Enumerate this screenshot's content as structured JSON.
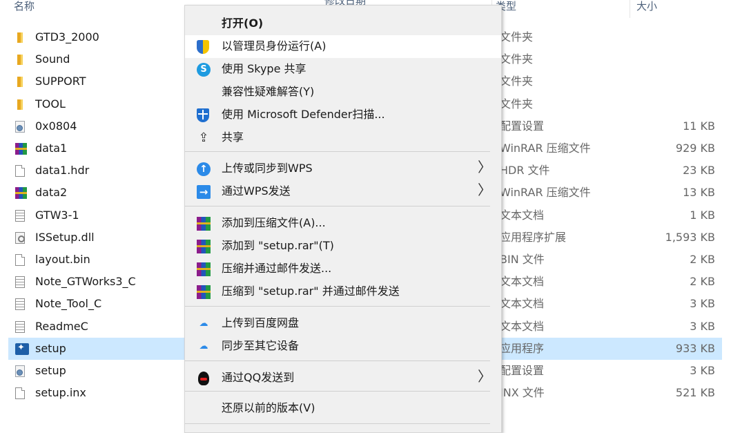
{
  "explorer": {
    "headers": {
      "name": "名称",
      "date": "修改日期",
      "type": "类型",
      "size": "大小"
    },
    "rows": [
      {
        "name": "GTD3_2000",
        "type": "文件夹",
        "size": "",
        "icon": "folder-icon"
      },
      {
        "name": "Sound",
        "type": "文件夹",
        "size": "",
        "icon": "folder-icon"
      },
      {
        "name": "SUPPORT",
        "type": "文件夹",
        "size": "",
        "icon": "folder-icon"
      },
      {
        "name": "TOOL",
        "type": "文件夹",
        "size": "",
        "icon": "folder-icon"
      },
      {
        "name": "0x0804",
        "type": "配置设置",
        "size": "11 KB",
        "icon": "config-file-icon"
      },
      {
        "name": "data1",
        "type": "WinRAR 压缩文件",
        "size": "929 KB",
        "icon": "winrar-archive-icon"
      },
      {
        "name": "data1.hdr",
        "type": "HDR 文件",
        "size": "23 KB",
        "icon": "blank-file-icon"
      },
      {
        "name": "data2",
        "type": "WinRAR 压缩文件",
        "size": "13 KB",
        "icon": "winrar-archive-icon"
      },
      {
        "name": "GTW3-1",
        "type": "文本文档",
        "size": "1 KB",
        "icon": "text-file-icon"
      },
      {
        "name": "ISSetup.dll",
        "type": "应用程序扩展",
        "size": "1,593 KB",
        "icon": "dll-file-icon"
      },
      {
        "name": "layout.bin",
        "type": "BIN 文件",
        "size": "2 KB",
        "icon": "blank-file-icon"
      },
      {
        "name": "Note_GTWorks3_C",
        "type": "文本文档",
        "size": "2 KB",
        "icon": "text-file-icon"
      },
      {
        "name": "Note_Tool_C",
        "type": "文本文档",
        "size": "3 KB",
        "icon": "text-file-icon"
      },
      {
        "name": "ReadmeC",
        "type": "文本文档",
        "size": "3 KB",
        "icon": "text-file-icon"
      },
      {
        "name": "setup",
        "type": "应用程序",
        "size": "933 KB",
        "icon": "setup-app-icon"
      },
      {
        "name": "setup",
        "type": "配置设置",
        "size": "3 KB",
        "icon": "config-file-icon"
      },
      {
        "name": "setup.inx",
        "type": "INX 文件",
        "size": "521 KB",
        "icon": "blank-file-icon"
      }
    ],
    "selected_row": 14
  },
  "context_menu": {
    "items": [
      {
        "label": "打开(O)",
        "icon": "",
        "bold": true
      },
      {
        "label": "以管理员身份运行(A)",
        "icon": "uac-shield-icon",
        "hover": true
      },
      {
        "label": "使用 Skype 共享",
        "icon": "skype-icon",
        "glyph": "S"
      },
      {
        "label": "兼容性疑难解答(Y)",
        "icon": ""
      },
      {
        "label": "使用 Microsoft Defender扫描...",
        "icon": "defender-icon"
      },
      {
        "label": "共享",
        "icon": "share-icon",
        "glyph": "⇪"
      },
      {
        "label": "上传或同步到WPS",
        "icon": "wps-cloud-icon",
        "glyph": "↑",
        "submenu": true
      },
      {
        "label": "通过WPS发送",
        "icon": "wps-send-icon",
        "glyph": "→",
        "submenu": true
      },
      {
        "label": "添加到压缩文件(A)...",
        "icon": "winrar-icon"
      },
      {
        "label": "添加到 \"setup.rar\"(T)",
        "icon": "winrar-icon"
      },
      {
        "label": "压缩并通过邮件发送...",
        "icon": "winrar-icon"
      },
      {
        "label": "压缩到 \"setup.rar\" 并通过邮件发送",
        "icon": "winrar-icon"
      },
      {
        "label": "上传到百度网盘",
        "icon": "baidu-netdisk-icon",
        "glyph": "☁"
      },
      {
        "label": "同步至其它设备",
        "icon": "baidu-netdisk-icon",
        "glyph": "☁"
      },
      {
        "label": "通过QQ发送到",
        "icon": "qq-icon",
        "submenu": true
      },
      {
        "label": "还原以前的版本(V)",
        "icon": ""
      }
    ],
    "submenu_chevron": "〉"
  }
}
